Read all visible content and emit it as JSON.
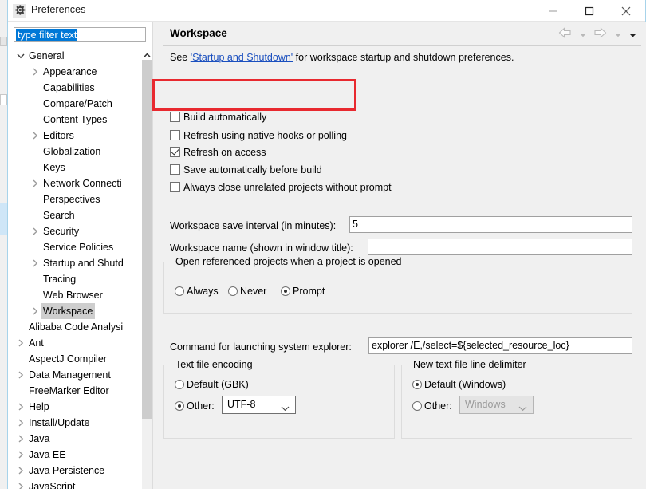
{
  "window": {
    "title": "Preferences",
    "icon": "gear-icon",
    "controls": {
      "minimize": "minimize-icon",
      "maximize": "maximize-icon",
      "close": "close-icon"
    }
  },
  "filter": {
    "value": "type filter text",
    "placeholder": "type filter text"
  },
  "tree": {
    "items": [
      {
        "label": "General",
        "indent": 0,
        "twisty": "expanded",
        "selected": false
      },
      {
        "label": "Appearance",
        "indent": 1,
        "twisty": "collapsed",
        "selected": false
      },
      {
        "label": "Capabilities",
        "indent": 1,
        "twisty": "none",
        "selected": false
      },
      {
        "label": "Compare/Patch",
        "indent": 1,
        "twisty": "none",
        "selected": false
      },
      {
        "label": "Content Types",
        "indent": 1,
        "twisty": "none",
        "selected": false
      },
      {
        "label": "Editors",
        "indent": 1,
        "twisty": "collapsed",
        "selected": false
      },
      {
        "label": "Globalization",
        "indent": 1,
        "twisty": "none",
        "selected": false
      },
      {
        "label": "Keys",
        "indent": 1,
        "twisty": "none",
        "selected": false
      },
      {
        "label": "Network Connecti",
        "indent": 1,
        "twisty": "collapsed",
        "selected": false
      },
      {
        "label": "Perspectives",
        "indent": 1,
        "twisty": "none",
        "selected": false
      },
      {
        "label": "Search",
        "indent": 1,
        "twisty": "none",
        "selected": false
      },
      {
        "label": "Security",
        "indent": 1,
        "twisty": "collapsed",
        "selected": false
      },
      {
        "label": "Service Policies",
        "indent": 1,
        "twisty": "none",
        "selected": false
      },
      {
        "label": "Startup and Shutd",
        "indent": 1,
        "twisty": "collapsed",
        "selected": false
      },
      {
        "label": "Tracing",
        "indent": 1,
        "twisty": "none",
        "selected": false
      },
      {
        "label": "Web Browser",
        "indent": 1,
        "twisty": "none",
        "selected": false
      },
      {
        "label": "Workspace",
        "indent": 1,
        "twisty": "collapsed",
        "selected": true
      },
      {
        "label": "Alibaba Code Analysi",
        "indent": 0,
        "twisty": "none",
        "selected": false
      },
      {
        "label": "Ant",
        "indent": 0,
        "twisty": "collapsed",
        "selected": false
      },
      {
        "label": "AspectJ Compiler",
        "indent": 0,
        "twisty": "none",
        "selected": false
      },
      {
        "label": "Data Management",
        "indent": 0,
        "twisty": "collapsed",
        "selected": false
      },
      {
        "label": "FreeMarker Editor",
        "indent": 0,
        "twisty": "none",
        "selected": false
      },
      {
        "label": "Help",
        "indent": 0,
        "twisty": "collapsed",
        "selected": false
      },
      {
        "label": "Install/Update",
        "indent": 0,
        "twisty": "collapsed",
        "selected": false
      },
      {
        "label": "Java",
        "indent": 0,
        "twisty": "collapsed",
        "selected": false
      },
      {
        "label": "Java EE",
        "indent": 0,
        "twisty": "collapsed",
        "selected": false
      },
      {
        "label": "Java Persistence",
        "indent": 0,
        "twisty": "collapsed",
        "selected": false
      },
      {
        "label": "JavaScript",
        "indent": 0,
        "twisty": "collapsed",
        "selected": false
      }
    ]
  },
  "panel": {
    "title": "Workspace",
    "description_before": "See ",
    "description_link": "'Startup and Shutdown'",
    "description_after": " for workspace startup and shutdown preferences.",
    "nav": {
      "back": "back-arrow-icon",
      "back_menu": "chevron-down-icon",
      "forward": "forward-arrow-icon",
      "forward_menu": "chevron-down-icon",
      "overflow_menu": "chevron-down-icon"
    },
    "highlight_color": "#e8292f",
    "checkboxes": [
      {
        "label": "Build automatically",
        "checked": false
      },
      {
        "label": "Refresh using native hooks or polling",
        "checked": false
      },
      {
        "label": "Refresh on access",
        "checked": true
      },
      {
        "label": "Save automatically before build",
        "checked": false
      },
      {
        "label": "Always close unrelated projects without prompt",
        "checked": false
      }
    ],
    "save_interval": {
      "label": "Workspace save interval (in minutes):",
      "value": "5"
    },
    "workspace_name": {
      "label": "Workspace name (shown in window title):",
      "value": ""
    },
    "referenced_projects": {
      "title": "Open referenced projects when a project is opened",
      "options": [
        {
          "label": "Always",
          "selected": false
        },
        {
          "label": "Never",
          "selected": false
        },
        {
          "label": "Prompt",
          "selected": true
        }
      ]
    },
    "system_explorer": {
      "label": "Command for launching system explorer:",
      "value": "explorer /E,/select=${selected_resource_loc}"
    },
    "text_file_encoding": {
      "title": "Text file encoding",
      "default_label": "Default (GBK)",
      "default_selected": false,
      "other_label": "Other:",
      "other_selected": true,
      "other_value": "UTF-8",
      "other_disabled": false
    },
    "line_delimiter": {
      "title": "New text file line delimiter",
      "default_label": "Default (Windows)",
      "default_selected": true,
      "other_label": "Other:",
      "other_selected": false,
      "other_value": "Windows",
      "other_disabled": true
    }
  }
}
